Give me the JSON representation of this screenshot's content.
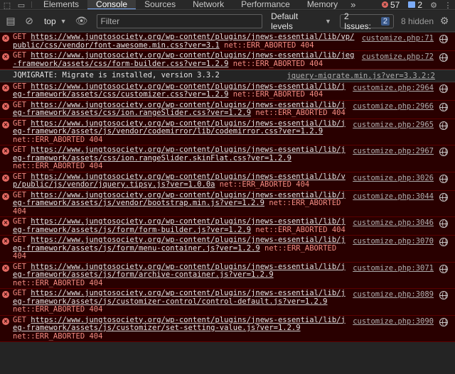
{
  "tabbar": {
    "tabs": [
      "Elements",
      "Console",
      "Sources",
      "Network",
      "Performance",
      "Memory"
    ],
    "active": "Console",
    "more": "»",
    "error_count": "57",
    "message_count": "2",
    "settings_icon": "gear-icon",
    "menu_icon": "kebab-icon"
  },
  "filterbar": {
    "context": "top",
    "filter_placeholder": "Filter",
    "levels": "Default levels",
    "issues_label": "2 Issues:",
    "issues_count": "2",
    "hidden": "8 hidden"
  },
  "rows": [
    {
      "type": "error",
      "prefix": "GET ",
      "url1": "https://www.jungtosociety.org/wp-content/plugins/jnews-essential/lib/vp/",
      "url2": "public/css/vendor/font-awesome.min.css?ver=3.1",
      "rest2": " net::ERR_ABORTED 404",
      "line3": "",
      "source": "customize.php:71"
    },
    {
      "type": "error",
      "prefix": "GET ",
      "url1": "https://www.jungtosociety.org/wp-content/plugins/jnews-essential/lib/jeg",
      "url2": "-framework/assets/css/form-builder.css?ver=1.2.9",
      "rest2": " net::ERR_ABORTED 404",
      "line3": "",
      "source": "customize.php:72"
    },
    {
      "type": "info",
      "text": "JQMIGRATE: Migrate is installed, version 3.3.2",
      "source": "jquery-migrate.min.js?ver=3.3.2:2"
    },
    {
      "type": "error",
      "prefix": "GET ",
      "url1": "https://www.jungtosociety.org/wp-content/plugins/jnews-essential/lib/j",
      "url2": "eg-framework/assets/css/customizer.css?ver=1.2.9",
      "rest2": " net::ERR_ABORTED 404",
      "line3": "",
      "source": "customize.php:2964"
    },
    {
      "type": "error",
      "prefix": "GET ",
      "url1": "https://www.jungtosociety.org/wp-content/plugins/jnews-essential/lib/j",
      "url2": "eg-framework/assets/css/ion.rangeSlider.css?ver=1.2.9",
      "rest2": " net::ERR_ABORTED 404",
      "line3": "",
      "source": "customize.php:2966"
    },
    {
      "type": "error",
      "prefix": "GET ",
      "url1": "https://www.jungtosociety.org/wp-content/plugins/jnews-essential/lib/j",
      "url2": "eg-framework/assets/js/vendor/codemirror/lib/codemirror.css?ver=1.2.9",
      "rest2": "",
      "line3": "net::ERR_ABORTED 404",
      "source": "customize.php:2965"
    },
    {
      "type": "error",
      "prefix": "GET ",
      "url1": "https://www.jungtosociety.org/wp-content/plugins/jnews-essential/lib/j",
      "url2": "eg-framework/assets/css/ion.rangeSlider.skinFlat.css?ver=1.2.9",
      "rest2": "",
      "line3": "net::ERR_ABORTED 404",
      "source": "customize.php:2967"
    },
    {
      "type": "error",
      "prefix": "GET ",
      "url1": "https://www.jungtosociety.org/wp-content/plugins/jnews-essential/lib/v",
      "url2": "p/public/js/vendor/jquery.tipsy.js?ver=1.0.0a",
      "rest2": " net::ERR_ABORTED 404",
      "line3": "",
      "source": "customize.php:3026"
    },
    {
      "type": "error",
      "prefix": "GET ",
      "url1": "https://www.jungtosociety.org/wp-content/plugins/jnews-essential/lib/j",
      "url2": "eg-framework/assets/js/vendor/bootstrap.min.js?ver=1.2.9",
      "rest2": " net::ERR_ABORTED",
      "line3": "404",
      "source": "customize.php:3044"
    },
    {
      "type": "error",
      "prefix": "GET ",
      "url1": "https://www.jungtosociety.org/wp-content/plugins/jnews-essential/lib/j",
      "url2": "eg-framework/assets/js/form/form-builder.js?ver=1.2.9",
      "rest2": " net::ERR_ABORTED 404",
      "line3": "",
      "source": "customize.php:3046"
    },
    {
      "type": "error",
      "prefix": "GET ",
      "url1": "https://www.jungtosociety.org/wp-content/plugins/jnews-essential/lib/j",
      "url2": "eg-framework/assets/js/form/menu-container.js?ver=1.2.9",
      "rest2": " net::ERR_ABORTED",
      "line3": "404",
      "source": "customize.php:3070"
    },
    {
      "type": "error",
      "prefix": "GET ",
      "url1": "https://www.jungtosociety.org/wp-content/plugins/jnews-essential/lib/j",
      "url2": "eg-framework/assets/js/form/archive-container.js?ver=1.2.9",
      "rest2": "",
      "line3": "net::ERR_ABORTED 404",
      "source": "customize.php:3071"
    },
    {
      "type": "error",
      "prefix": "GET ",
      "url1": "https://www.jungtosociety.org/wp-content/plugins/jnews-essential/lib/j",
      "url2": "eg-framework/assets/js/customizer-control/control-default.js?ver=1.2.9",
      "rest2": "",
      "line3": "net::ERR_ABORTED 404",
      "source": "customize.php:3089"
    },
    {
      "type": "error",
      "prefix": "GET ",
      "url1": "https://www.jungtosociety.org/wp-content/plugins/jnews-essential/lib/j",
      "url2": "eg-framework/assets/js/customizer/set-setting-value.js?ver=1.2.9",
      "rest2": "",
      "line3": "net::ERR_ABORTED 404",
      "source": "customize.php:3090"
    }
  ]
}
